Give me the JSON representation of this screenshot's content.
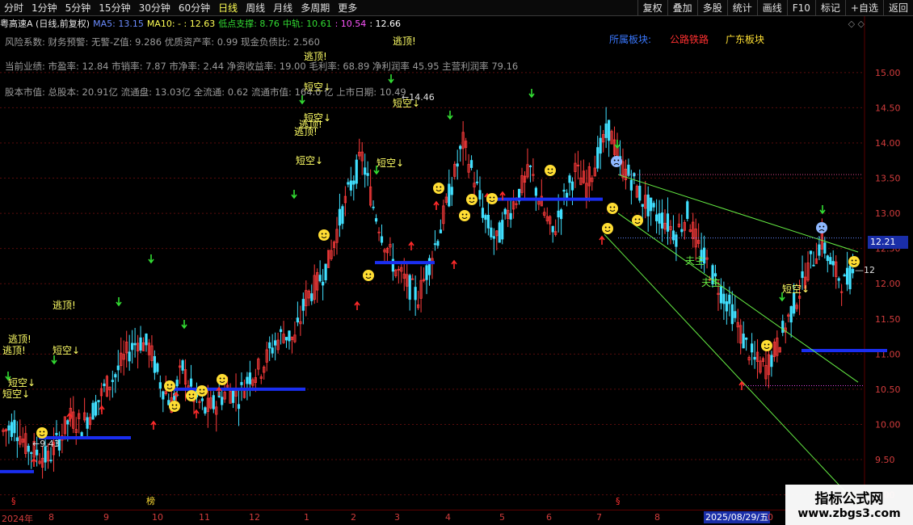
{
  "toolbar": {
    "left_items": [
      "分时",
      "1分钟",
      "5分钟",
      "15分钟",
      "30分钟",
      "60分钟",
      "日线",
      "周线",
      "月线",
      "多周期",
      "更多"
    ],
    "active_index": 6,
    "right_buttons": [
      "复权",
      "叠加",
      "多股",
      "统计",
      "画线",
      "F10",
      "标记",
      "+自选",
      "返回"
    ]
  },
  "info": {
    "title": "粤高速A (日线,前复权)",
    "ma5_label": "MA5: 13.15",
    "ma10_label": "MA10: - : 12.63",
    "low_support": "低点支撑: 8.76",
    "mid_track": "中轨: 10.61",
    "upper": ": 10.54",
    "last": ": 12.66"
  },
  "fundamentals": {
    "line1": "风险系数: 财务预警: 无警-Z值: 9.286 优质资产率: 0.99 现金负债比: 2.560",
    "line2": "当前业绩: 市盈率: 12.84 市销率: 7.87 市净率: 2.44 净资收益率: 19.00 毛利率: 68.89 净利润率 45.95 主营利润率 79.16",
    "line3": "股本市值: 总股本: 20.91亿 流通盘: 13.03亿 全流通: 0.62 流通市值: 164.0 亿 上市日期: 10.49"
  },
  "sectors": [
    "所属板块:",
    "公路铁路",
    "广东板块"
  ],
  "colors": {
    "up": "#ff3c3c",
    "down": "#40e0ff",
    "yellow": "#ffff33",
    "blue_line": "#1a2ef0",
    "green": "#33dd33",
    "axis_red": "#d23c3c",
    "channel": "#66ee44"
  },
  "price_box": "12.21",
  "last_price_note": "12",
  "low_marker": "9.43",
  "high_marker": "14.46",
  "date_axis": [
    "2024年",
    "8",
    "9",
    "10",
    "11",
    "12",
    "1",
    "2",
    "3",
    "4",
    "5",
    "6",
    "7",
    "8",
    "0"
  ],
  "date_selected": "2025/08/29/五",
  "bottom_marks": [
    "§",
    "榜",
    "§"
  ],
  "signals": {
    "escape_top": "逃顶!",
    "short": "短空↓",
    "bull": "夫主"
  },
  "watermark": {
    "line1": "指标公式网",
    "line2": "www.zbgs3.com"
  },
  "chart_data": {
    "type": "candlestick",
    "ylim": [
      8.8,
      15.4
    ],
    "yticks": [
      9.0,
      9.5,
      10.0,
      10.5,
      11.0,
      11.5,
      12.0,
      12.5,
      13.0,
      13.5,
      14.0,
      14.5,
      15.0
    ],
    "ytick_labels": [
      "9.00",
      "9.50",
      "10.00",
      "10.50",
      "11.00",
      "11.50",
      "12.00",
      "12.50",
      "13.00",
      "13.50",
      "14.00",
      "14.50",
      "15.00"
    ],
    "x_months": [
      "2024年",
      "8",
      "9",
      "10",
      "11",
      "12",
      "1",
      "2",
      "3",
      "4",
      "5",
      "6",
      "7",
      "8",
      "0"
    ],
    "close_path": [
      [
        0,
        9.9
      ],
      [
        4,
        10.0
      ],
      [
        8,
        9.7
      ],
      [
        12,
        9.6
      ],
      [
        16,
        9.5
      ],
      [
        20,
        9.8
      ],
      [
        24,
        10.1
      ],
      [
        28,
        10.0
      ],
      [
        32,
        10.2
      ],
      [
        36,
        10.5
      ],
      [
        40,
        10.7
      ],
      [
        44,
        11.0
      ],
      [
        48,
        11.2
      ],
      [
        52,
        11.1
      ],
      [
        56,
        10.6
      ],
      [
        60,
        10.3
      ],
      [
        64,
        10.8
      ],
      [
        68,
        10.4
      ],
      [
        72,
        10.2
      ],
      [
        76,
        10.3
      ],
      [
        80,
        10.5
      ],
      [
        84,
        10.4
      ],
      [
        88,
        10.7
      ],
      [
        92,
        10.8
      ],
      [
        96,
        11.1
      ],
      [
        100,
        11.3
      ],
      [
        104,
        11.2
      ],
      [
        108,
        11.8
      ],
      [
        112,
        12.0
      ],
      [
        116,
        12.3
      ],
      [
        120,
        12.9
      ],
      [
        124,
        13.4
      ],
      [
        128,
        13.8
      ],
      [
        132,
        13.1
      ],
      [
        136,
        12.6
      ],
      [
        140,
        12.2
      ],
      [
        144,
        12.0
      ],
      [
        148,
        11.8
      ],
      [
        152,
        12.3
      ],
      [
        156,
        12.8
      ],
      [
        160,
        13.4
      ],
      [
        164,
        14.0
      ],
      [
        168,
        13.5
      ],
      [
        172,
        12.9
      ],
      [
        176,
        12.6
      ],
      [
        180,
        13.0
      ],
      [
        184,
        13.3
      ],
      [
        188,
        13.6
      ],
      [
        192,
        13.1
      ],
      [
        196,
        12.7
      ],
      [
        200,
        13.2
      ],
      [
        204,
        13.6
      ],
      [
        208,
        13.4
      ],
      [
        212,
        13.8
      ],
      [
        216,
        14.2
      ],
      [
        220,
        13.7
      ],
      [
        224,
        13.5
      ],
      [
        228,
        13.2
      ],
      [
        232,
        13.0
      ],
      [
        236,
        12.9
      ],
      [
        240,
        12.7
      ],
      [
        244,
        13.0
      ],
      [
        248,
        12.5
      ],
      [
        252,
        12.2
      ],
      [
        256,
        11.9
      ],
      [
        260,
        11.6
      ],
      [
        264,
        11.2
      ],
      [
        268,
        10.9
      ],
      [
        272,
        10.8
      ],
      [
        276,
        11.1
      ],
      [
        280,
        11.5
      ],
      [
        284,
        11.9
      ],
      [
        288,
        12.3
      ],
      [
        292,
        12.6
      ],
      [
        296,
        12.2
      ],
      [
        300,
        12.0
      ],
      [
        304,
        12.2
      ]
    ],
    "horizontal_levels": [
      {
        "from": 0,
        "to": 20,
        "value": 9.33
      },
      {
        "from": 30,
        "to": 95,
        "value": 9.81
      },
      {
        "from": 130,
        "to": 230,
        "value": 10.5
      },
      {
        "from": 290,
        "to": 330,
        "value": 12.3
      },
      {
        "from": 380,
        "to": 460,
        "value": 13.2
      },
      {
        "from": 620,
        "to": 680,
        "value": 11.05
      }
    ]
  }
}
